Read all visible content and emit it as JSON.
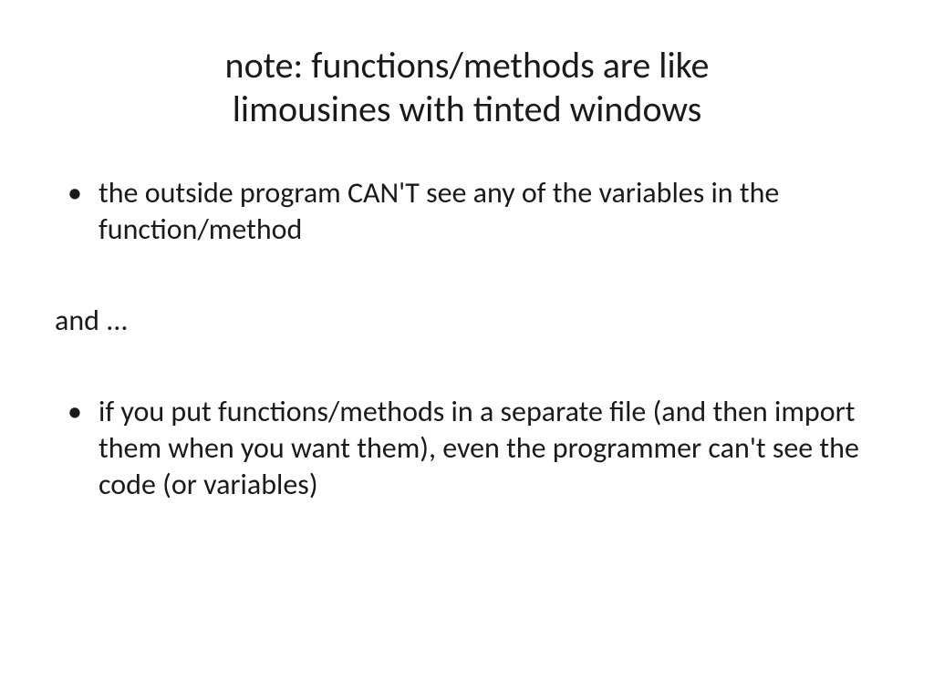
{
  "title": {
    "line1": "note: functions/methods are like",
    "line2": "limousines with tinted windows"
  },
  "bullets": {
    "first": "the outside program CAN'T see any of the variables in the function/method",
    "middle": "and ...",
    "second": "if you put functions/methods in a separate file (and then import them when you want them), even the programmer can't see the code (or variables)"
  }
}
